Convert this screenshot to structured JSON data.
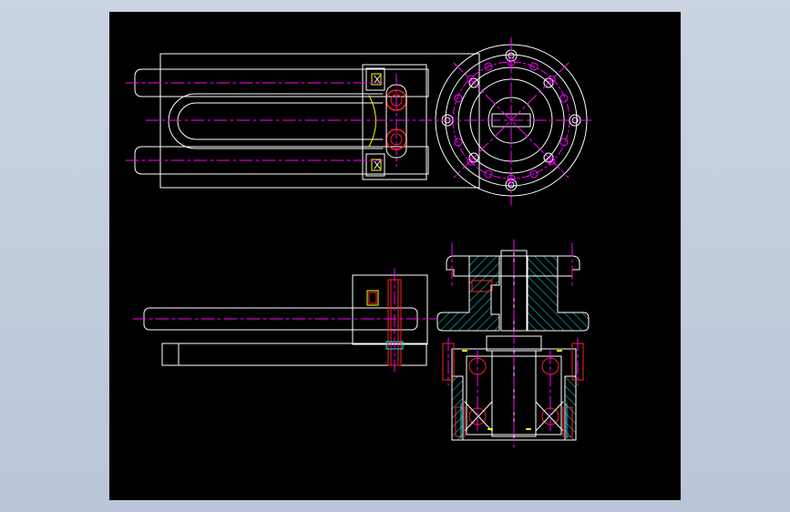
{
  "viewer": {
    "background": "#c4cfdf",
    "canvas_color": "#000000"
  },
  "drawing": {
    "colors": {
      "outline": "#ffffff",
      "centerline": "#ff00ff",
      "bolt": "#ff2020",
      "hatch": "#00c8c8",
      "bearing": "#ff2020",
      "cyan": "#00e0ff",
      "yellow": "#ffff00"
    }
  }
}
